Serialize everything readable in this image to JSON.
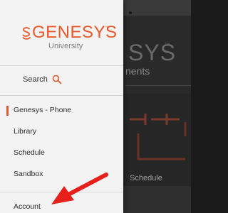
{
  "background_app": {
    "brand_partial": "SYS",
    "subtitle_partial": "nents",
    "card_label_partial": "Schedule"
  },
  "drawer": {
    "logo": {
      "wordmark": "GENESYS",
      "subtitle": "University"
    },
    "search": {
      "label": "Search"
    },
    "items": [
      {
        "label": "Genesys - Phone",
        "active": true
      },
      {
        "label": "Library",
        "active": false
      },
      {
        "label": "Schedule",
        "active": false
      },
      {
        "label": "Sandbox",
        "active": false
      },
      {
        "label": "Account",
        "active": false
      }
    ]
  },
  "colors": {
    "accent": "#e8582a",
    "annotation_arrow": "#e8201c",
    "drawer_bg": "#f3f3f3",
    "overlay_bg": "#2a2a2a"
  },
  "icons": {
    "search": "magnifier-icon",
    "logo_mark": "genesys-logo-icon",
    "annotation": "red-arrow-annotation"
  }
}
